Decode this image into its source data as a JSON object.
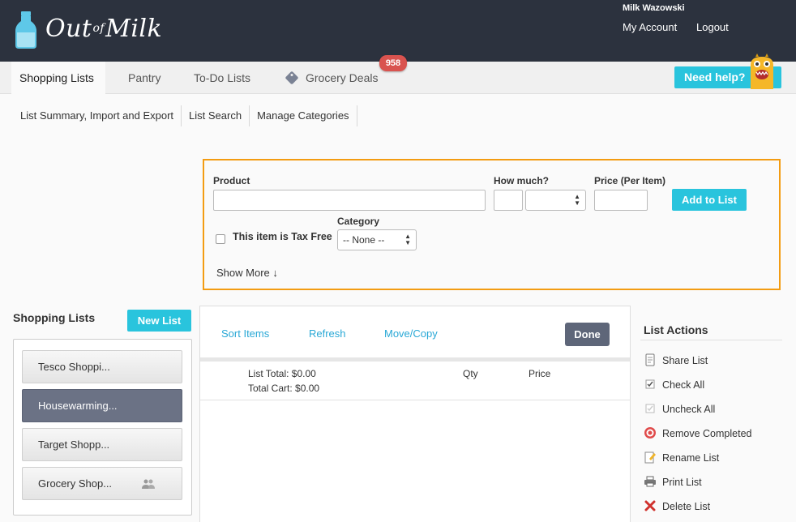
{
  "app": {
    "logo_text_1": "Out",
    "logo_text_of": "of",
    "logo_text_2": "Milk"
  },
  "user": {
    "name": "Milk Wazowski",
    "account_link": "My Account",
    "logout_link": "Logout"
  },
  "tabs": [
    {
      "label": "Shopping Lists",
      "active": true
    },
    {
      "label": "Pantry"
    },
    {
      "label": "To-Do Lists"
    },
    {
      "label": "Grocery Deals",
      "badge": "958"
    }
  ],
  "help": {
    "label": "Need help?"
  },
  "subnav": [
    "List Summary, Import and Export",
    "List Search",
    "Manage Categories"
  ],
  "add_item": {
    "product_label": "Product",
    "how_much_label": "How much?",
    "price_label": "Price (Per Item)",
    "add_button": "Add to List",
    "tax_free_label": "This item is Tax Free",
    "category_label": "Category",
    "category_value": "-- None --",
    "show_more": "Show More ↓"
  },
  "sidebar": {
    "title": "Shopping Lists",
    "new_list_button": "New List",
    "lists": [
      {
        "label": "Tesco Shoppi..."
      },
      {
        "label": "Housewarming...",
        "active": true
      },
      {
        "label": "Target Shopp..."
      },
      {
        "label": "Grocery Shop...",
        "shared": true
      }
    ]
  },
  "list_panel": {
    "sort_items": "Sort Items",
    "refresh": "Refresh",
    "move_copy": "Move/Copy",
    "done_button": "Done",
    "list_total": "List Total: $0.00",
    "total_cart": "Total Cart: $0.00",
    "qty_header": "Qty",
    "price_header": "Price"
  },
  "list_actions": {
    "title": "List Actions",
    "items": [
      "Share List",
      "Check All",
      "Uncheck All",
      "Remove Completed",
      "Rename List",
      "Print List",
      "Delete List"
    ]
  },
  "colors": {
    "accent": "#29c4dd",
    "header_bg": "#2c323e",
    "highlight_border": "#f39c12",
    "badge": "#d9534f",
    "active_list": "#6b7285"
  }
}
